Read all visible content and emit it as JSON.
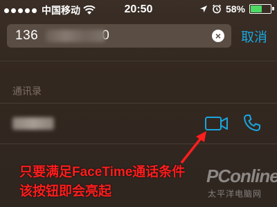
{
  "status_bar": {
    "carrier": "中国移动",
    "time": "20:50",
    "battery_percent_text": "58%",
    "battery_level": 0.58,
    "signal_dots": 5
  },
  "search": {
    "value_visible_prefix": "136",
    "value_visible_suffix": "0",
    "cancel_label": "取消"
  },
  "section_header": "通讯录",
  "contact": {
    "facetime_icon": "video-camera-icon",
    "phone_icon": "phone-icon"
  },
  "annotation": {
    "line1": "只要满足FaceTime通话条件",
    "line2": "该按钮即会亮起"
  },
  "watermark": {
    "logo": "PConline",
    "subtitle": "太平洋电脑网"
  },
  "colors": {
    "accent": "#1aa6e0",
    "annotation": "#ff1e1e",
    "battery": "#4cd964",
    "background": "#33281f"
  }
}
